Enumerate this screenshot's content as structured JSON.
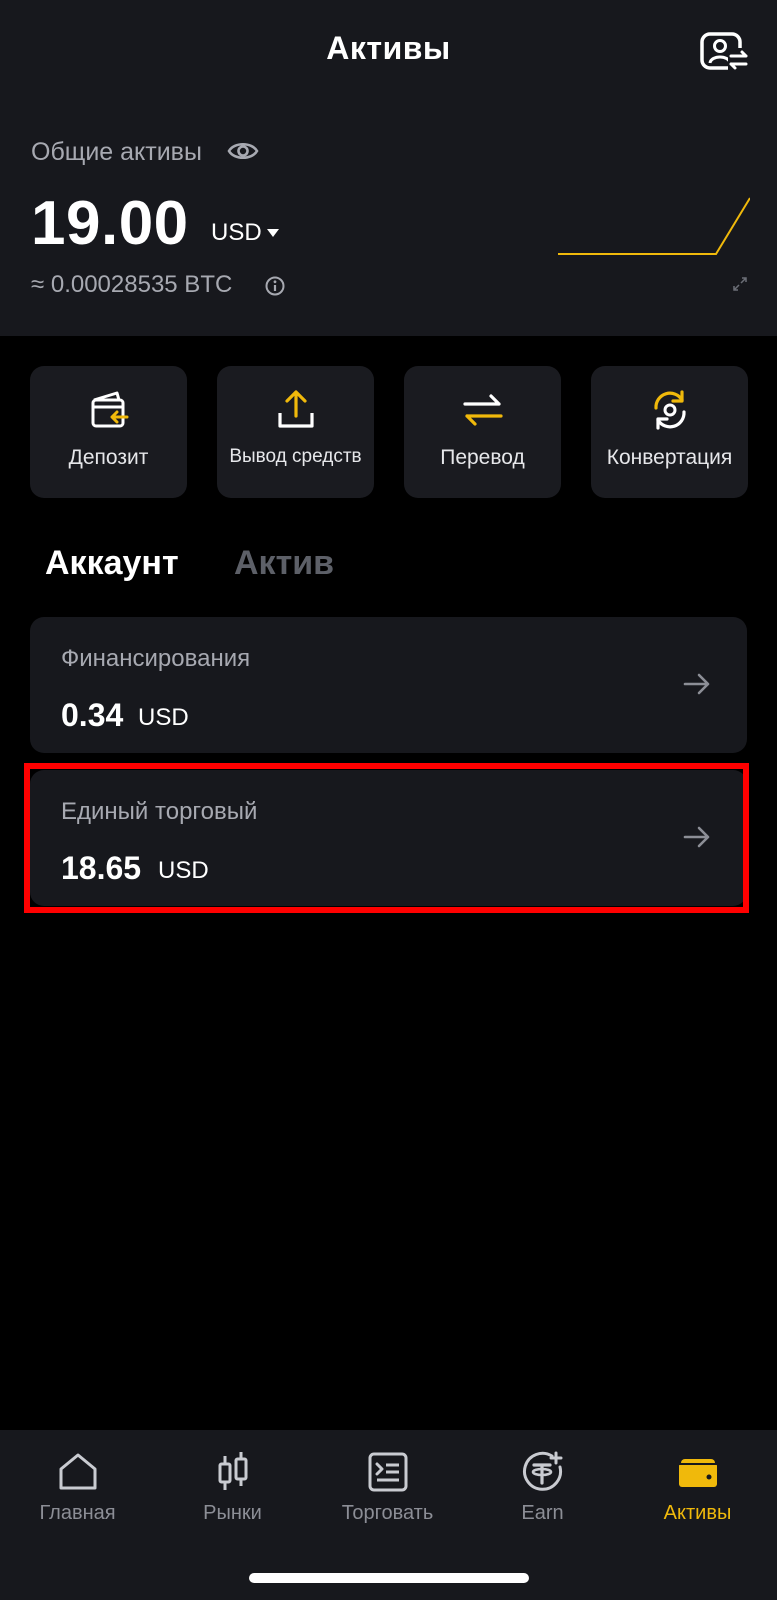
{
  "header": {
    "title": "Активы",
    "total_label": "Общие активы",
    "balance": "19.00",
    "currency": "USD",
    "btc_equivalent": "≈ 0.00028535 BTC"
  },
  "actions": [
    {
      "label": "Депозит",
      "icon": "deposit-icon"
    },
    {
      "label": "Вывод средств",
      "icon": "withdraw-icon"
    },
    {
      "label": "Перевод",
      "icon": "transfer-icon"
    },
    {
      "label": "Конвертация",
      "icon": "convert-icon"
    }
  ],
  "tabs": {
    "account": "Аккаунт",
    "asset": "Актив",
    "active": "account"
  },
  "accounts": [
    {
      "name": "Финансирования",
      "amount": "0.34",
      "unit": "USD"
    },
    {
      "name": "Единый торговый",
      "amount": "18.65",
      "unit": "USD",
      "highlighted": true
    }
  ],
  "bottom_nav": [
    {
      "label": "Главная",
      "icon": "home-icon"
    },
    {
      "label": "Рынки",
      "icon": "candlestick-icon"
    },
    {
      "label": "Торговать",
      "icon": "trade-icon"
    },
    {
      "label": "Earn",
      "icon": "earn-icon"
    },
    {
      "label": "Активы",
      "icon": "wallet-icon",
      "active": true
    }
  ],
  "colors": {
    "accent": "#f0b90b",
    "background": "#000000",
    "panel": "#17181d",
    "highlight_border": "#ff0000"
  }
}
